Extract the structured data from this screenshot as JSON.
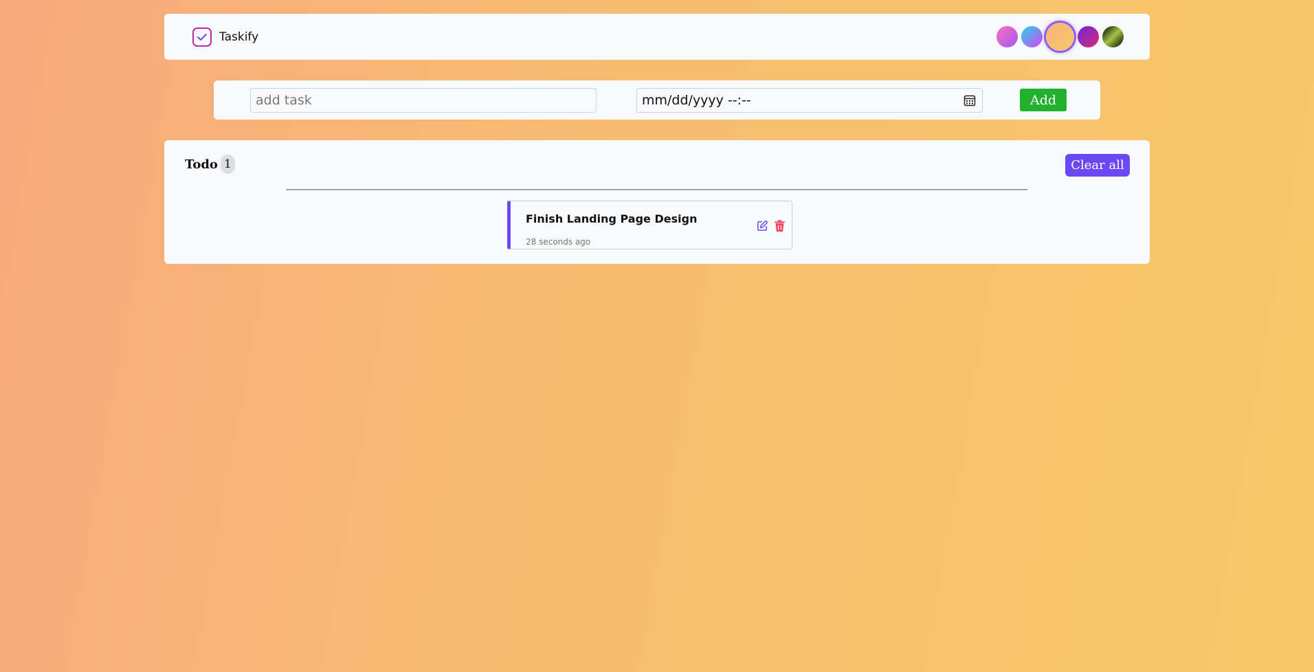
{
  "header": {
    "brand_name": "Taskify",
    "logo_icon": "checklist-icon",
    "theme_swatches": [
      {
        "name": "pink-purple",
        "from": "#f472b6",
        "to": "#a855f7"
      },
      {
        "name": "cyan-magenta",
        "from": "#22d3ee",
        "to": "#d946ef"
      },
      {
        "name": "peach-orange",
        "from": "#f8b27a",
        "to": "#f7c86c",
        "active": true
      },
      {
        "name": "purple-pink",
        "from": "#6d28d9",
        "to": "#db2777"
      },
      {
        "name": "olive-green",
        "from": "#3f4d1a",
        "to": "#a3c44a"
      }
    ]
  },
  "form": {
    "task_placeholder": "add task",
    "task_value": "",
    "date_value": "mm/dd/yyyy --:--",
    "date_icon": "calendar-icon",
    "add_label": "Add"
  },
  "todo": {
    "title": "Todo",
    "count": "1",
    "clear_label": "Clear all",
    "tasks": [
      {
        "name": "Finish Landing Page Design",
        "time": "28 seconds ago",
        "edit_icon": "edit-icon",
        "delete_icon": "trash-icon"
      }
    ]
  },
  "colors": {
    "accent": "#6a49f5",
    "add_button": "#22b12e",
    "delete": "#f43f5e",
    "logo": "#c026a3"
  }
}
